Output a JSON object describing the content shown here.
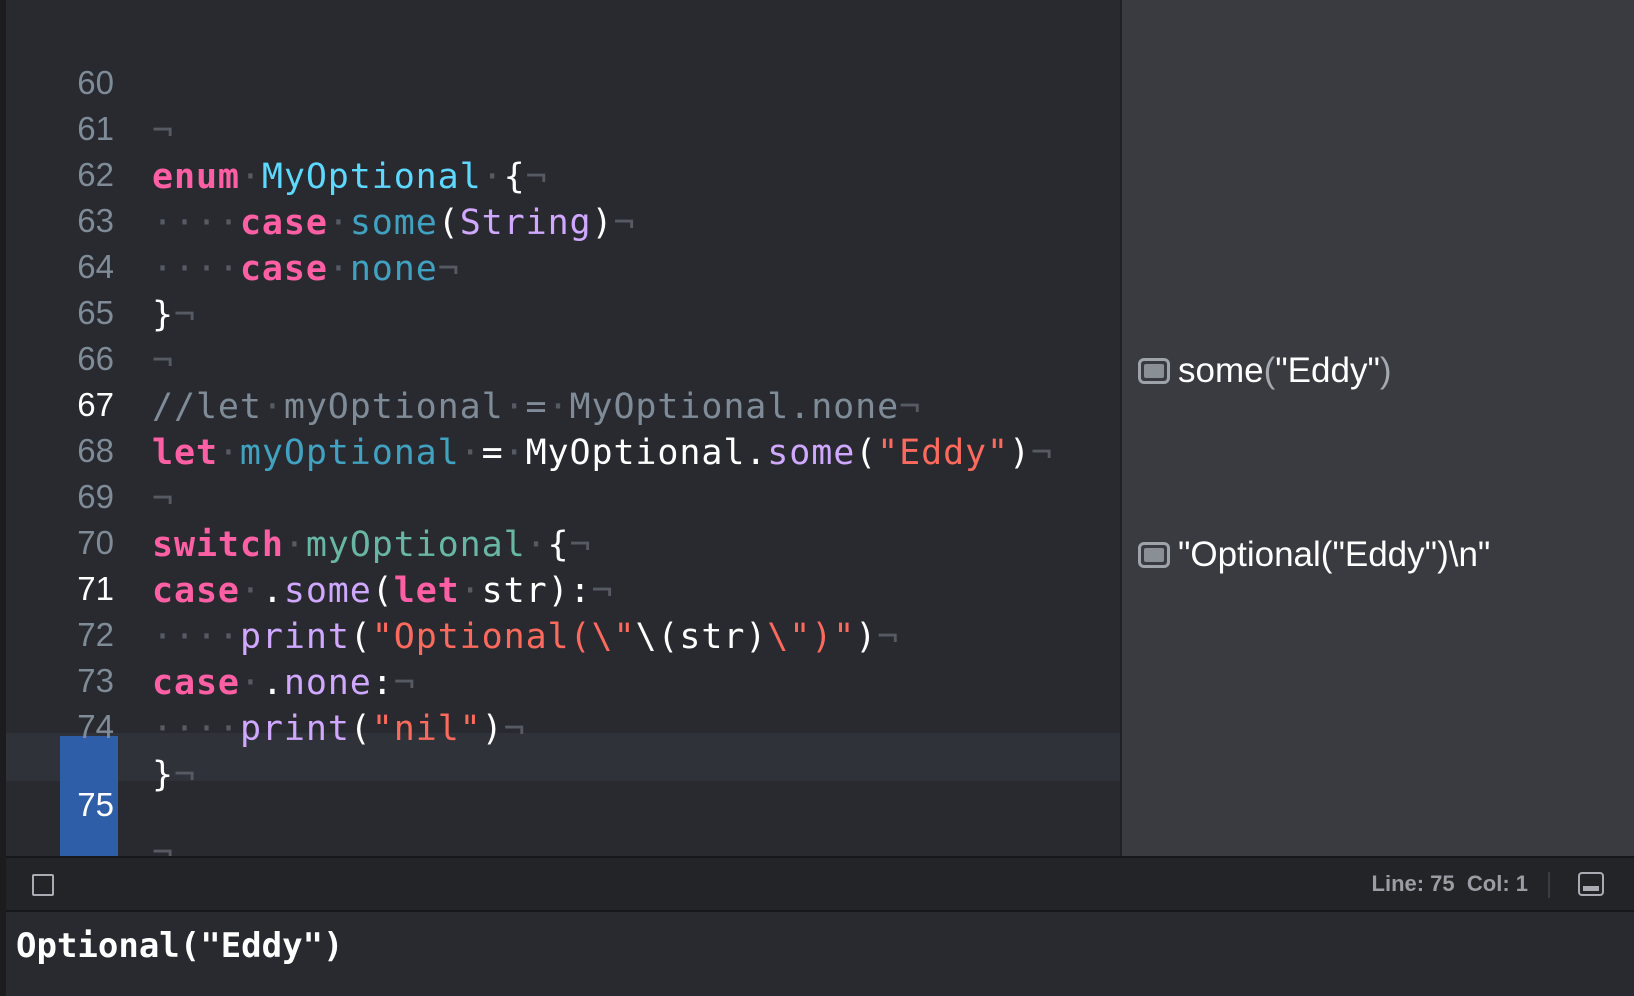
{
  "editor": {
    "ws_dot": "·",
    "ws_eol": "¬",
    "lines": {
      "l60": {
        "num": "60"
      },
      "l61": {
        "num": "61",
        "kw": "enum",
        "type": "MyOptional",
        "brace": "{"
      },
      "l62": {
        "num": "62",
        "kw": "case",
        "name": "some",
        "open": "(",
        "type": "String",
        "close": ")"
      },
      "l63": {
        "num": "63",
        "kw": "case",
        "name": "none"
      },
      "l64": {
        "num": "64",
        "brace": "}"
      },
      "l65": {
        "num": "65"
      },
      "l66": {
        "num": "66",
        "c1": "//let",
        "c2": "myOptional",
        "c3": "=",
        "c4": "MyOptional.none"
      },
      "l67": {
        "num": "67",
        "kw": "let",
        "name": "myOptional",
        "eq": "=",
        "type": "MyOptional.",
        "member": "some",
        "open": "(",
        "str": "\"Eddy\"",
        "close": ")"
      },
      "l68": {
        "num": "68"
      },
      "l69": {
        "num": "69",
        "kw": "switch",
        "name": "myOptional",
        "brace": "{"
      },
      "l70": {
        "num": "70",
        "kw": "case",
        "dot": ".",
        "member": "some",
        "open": "(",
        "kw2": "let",
        "var": "str",
        "close": "):"
      },
      "l71": {
        "num": "71",
        "fn": "print",
        "open": "(",
        "s1": "\"Optional(\\\"",
        "interp": "\\(str)",
        "s2": "\\\")\"",
        "close": ")"
      },
      "l72": {
        "num": "72",
        "kw": "case",
        "dot": ".",
        "member": "none",
        "colon": ":"
      },
      "l73": {
        "num": "73",
        "fn": "print",
        "open": "(",
        "str": "\"nil\"",
        "close": ")"
      },
      "l74": {
        "num": "74",
        "brace": "}"
      },
      "l75": {
        "num": "75"
      }
    }
  },
  "results": {
    "r67": {
      "name": "some",
      "open": "(",
      "value": "\"Eddy\"",
      "close": ")"
    },
    "r71": {
      "value": "\"Optional(\"Eddy\")\\n\""
    }
  },
  "status_bar": {
    "cursor_position": "Line: 75  Col: 1"
  },
  "console": {
    "output": "Optional(\"Eddy\")"
  }
}
